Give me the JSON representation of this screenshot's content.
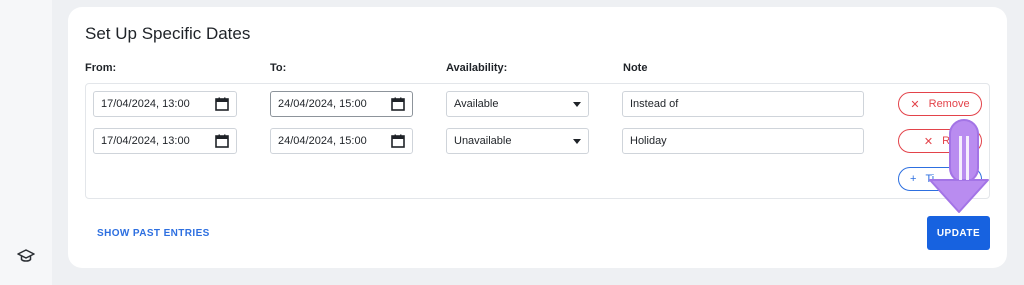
{
  "section": {
    "title": "Set Up Specific Dates"
  },
  "columns": {
    "from": "From:",
    "to": "To:",
    "availability": "Availability:",
    "note": "Note"
  },
  "rows": [
    {
      "from": "17/04/2024, 13:00",
      "to": "24/04/2024, 15:00",
      "availability": "Available",
      "note": "Instead of",
      "remove_label": "Remove"
    },
    {
      "from": "17/04/2024, 13:00",
      "to": "24/04/2024, 15:00",
      "availability": "Unavailable",
      "note": "Holiday",
      "remove_label": "Re"
    }
  ],
  "add_button": {
    "label": "Ti"
  },
  "footer": {
    "show_past": "SHOW PAST ENTRIES",
    "update": "UPDATE"
  },
  "icons": {
    "sidebar": "graduation-cap-icon",
    "calendar": "calendar-icon",
    "remove": "close-icon",
    "add": "plus-icon",
    "dropdown": "caret-down-icon",
    "overlay": "down-arrow-icon"
  },
  "colors": {
    "primary": "#1762e0",
    "danger": "#e3434a",
    "overlay_arrow": "#b98cf0"
  }
}
